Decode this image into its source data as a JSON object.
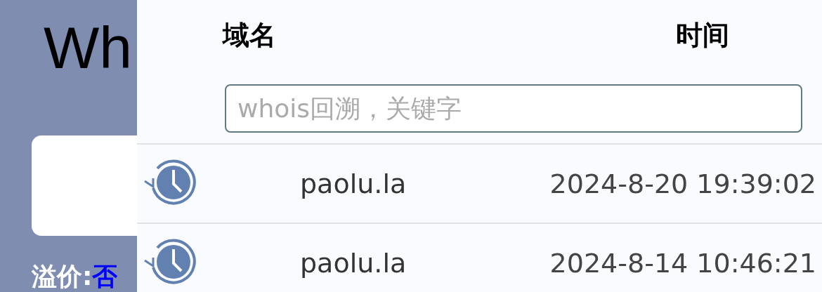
{
  "background_page": {
    "title": "Wh",
    "premium_label": "溢价:",
    "premium_value": "否"
  },
  "history_panel": {
    "columns": [
      "域名",
      "时间"
    ],
    "search": {
      "placeholder": "whois回溯，关键字"
    },
    "rows": [
      {
        "domain": "paolu.la",
        "time": "2024-8-20 19:39:02"
      },
      {
        "domain": "paolu.la",
        "time": "2024-8-14 10:46:21"
      }
    ]
  }
}
